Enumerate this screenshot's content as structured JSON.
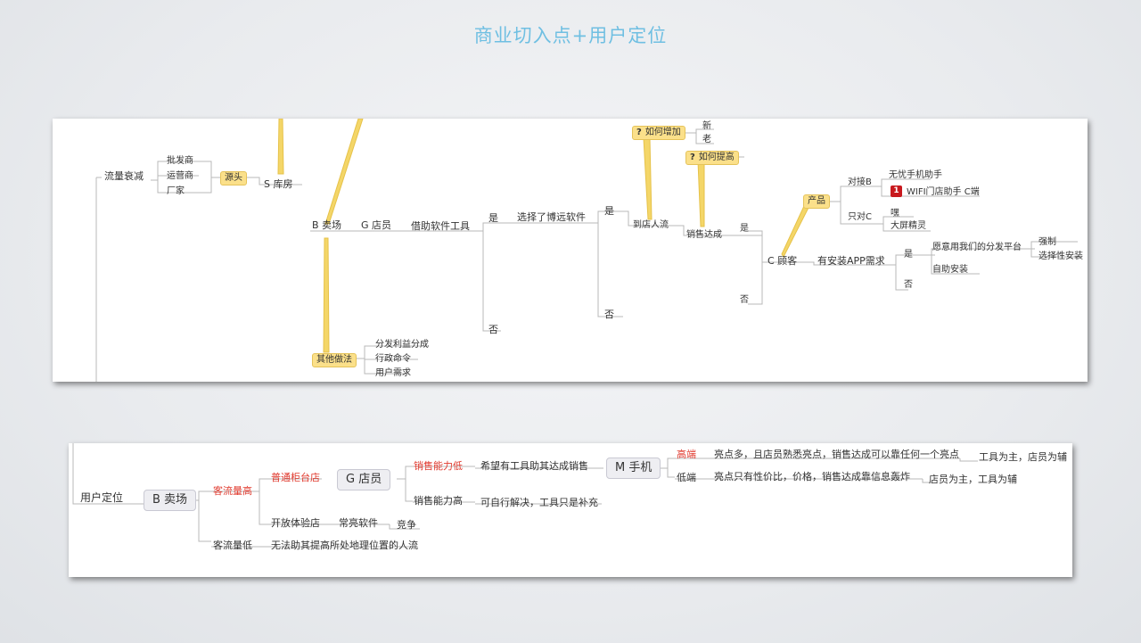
{
  "title": "商业切入点+用户定位",
  "top_map": {
    "liuliang": "流量衰减",
    "pifa": "批发商",
    "yunying": "运营商",
    "changjia": "厂家",
    "yuantou": "源头",
    "kufang": "S 库房",
    "maichang": "B 卖场",
    "dianyuan": "G  店员",
    "jiezhu": "借助软件工具",
    "shi1": "是",
    "fou1": "否",
    "xuanze": "选择了博远软件",
    "shi2": "是",
    "fou2": "否",
    "daodian": "到店人流",
    "ruhezengjia": "如何增加",
    "xin": "新",
    "lao": "老",
    "ruhetigao": "如何提高",
    "xiaoshou": "销售达成",
    "shi3": "是",
    "fou3": "否",
    "guke": "C 顾客",
    "chanpin": "产品",
    "duijieb": "对接B",
    "wuyou": "无忧手机助手",
    "wifi": "WIFI门店助手 C端",
    "badge": "1",
    "zhiduic": "只对C",
    "hei": "嘿",
    "daping": "大屏精灵",
    "anzhuang": "有安装APP需求",
    "shi4": "是",
    "fou4": "否",
    "yuanyi": "愿意用我们的分发平台",
    "zidong": "自助安装",
    "qiangzhi": "强制",
    "xuanzexing": "选择性安装",
    "qita": "其他做法",
    "fenfa": "分发利益分成",
    "xingzheng": "行政命令",
    "yonghu": "用户需求",
    "q": "?"
  },
  "bottom_map": {
    "yonghudingwei": "用户定位",
    "maichang": "B 卖场",
    "keliugao": "客流量高",
    "putong": "普通柜台店",
    "dianyuan": "G  店员",
    "nengli_di": "销售能力低",
    "xiwang": "希望有工具助其达成销售",
    "shouji": "M 手机",
    "gaoduan": "高端",
    "liangdianduo": "亮点多，且店员熟悉亮点，销售达成可以靠任何一个亮点",
    "gongjuzhu": "工具为主，店员为辅",
    "diduan": "低端",
    "liangdianshao": "亮点只有性价比，价格，销售达成靠信息轰炸",
    "dianyuanzhu": "店员为主，工具为辅",
    "nengli_gao": "销售能力高",
    "ziji": "可自行解决，工具只是补充",
    "kaifang": "开放体验店",
    "changliang": "常亮软件",
    "jingzheng": "竞争",
    "keliudi": "客流量低",
    "wufa": "无法助其提高所处地理位置的人流"
  },
  "colors": {
    "title": "#6fbfe2",
    "bubble": "#fbe08a",
    "red": "#e03a2e",
    "line": "#b5b5b5",
    "callout": "#f0c93a"
  }
}
